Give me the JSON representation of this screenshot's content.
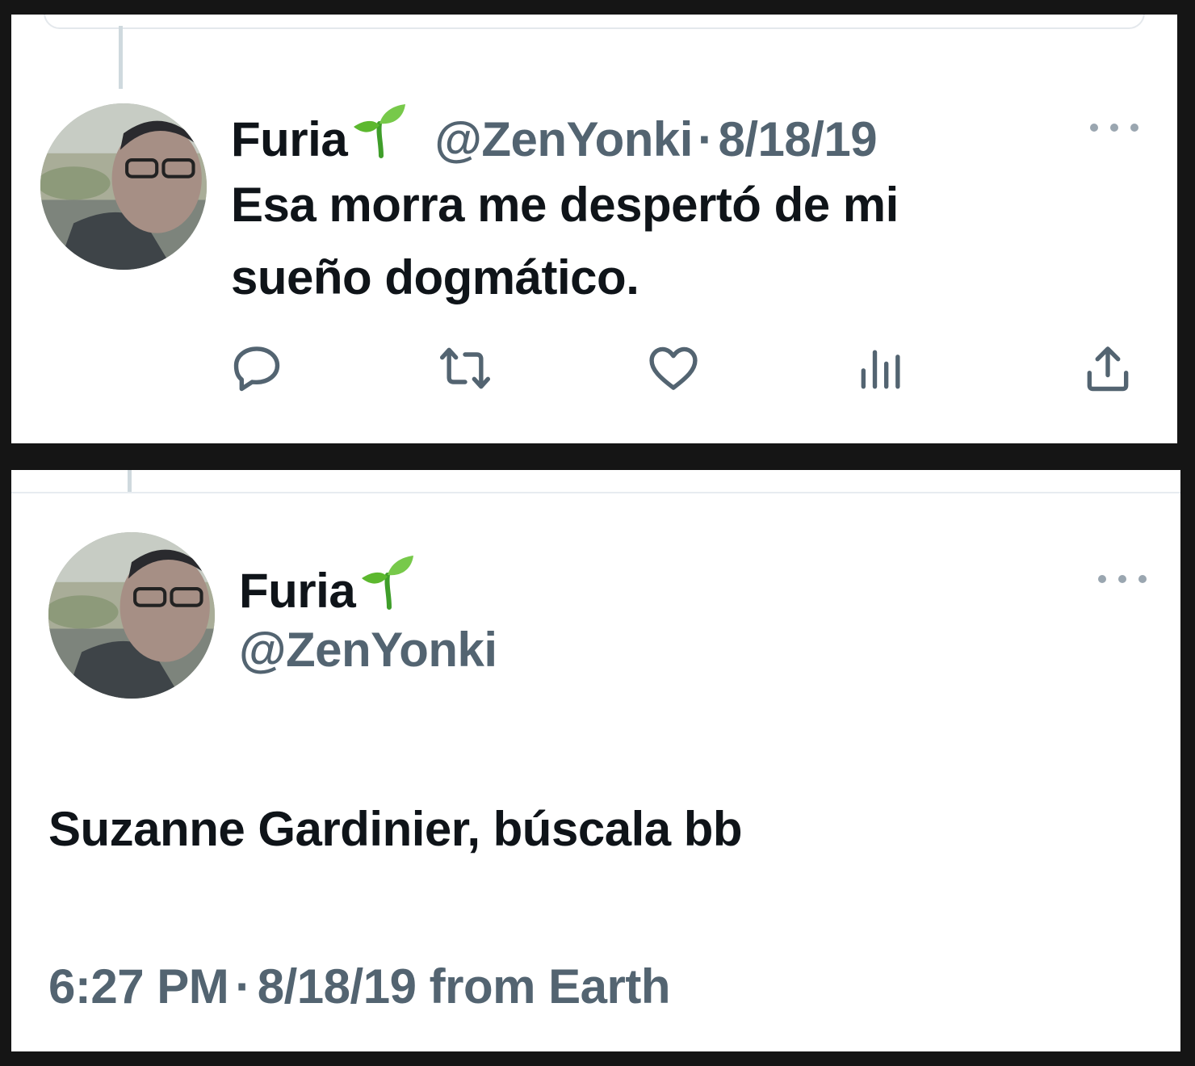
{
  "tweet_reply": {
    "display_name": "Furia",
    "handle": "@ZenYonki",
    "separator": "·",
    "date": "8/18/19",
    "text_line1": "Esa morra me despertó de mi",
    "text_line2": "sueño dogmático.",
    "actions": [
      "reply-icon",
      "retweet-icon",
      "like-icon",
      "views-icon",
      "share-icon"
    ]
  },
  "tweet_detail": {
    "display_name": "Furia",
    "handle": "@ZenYonki",
    "text": "Suzanne Gardinier, búscala bb",
    "time": "6:27 PM",
    "separator": "·",
    "date": "8/18/19",
    "source": "from Earth"
  },
  "colors": {
    "text_primary": "#0f1419",
    "text_secondary": "#536471",
    "sprout_green": "#5cb82e"
  }
}
